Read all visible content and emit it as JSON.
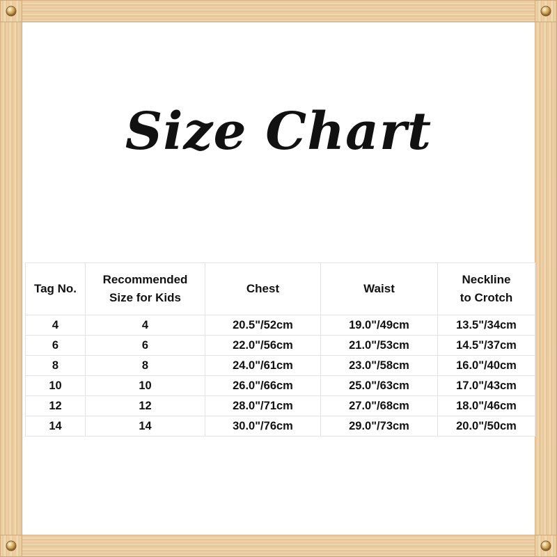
{
  "document": {
    "title": "Size Chart",
    "frame": {
      "material": "wood",
      "wood_color": "#eccb9c",
      "screw_color": "#b88b46",
      "screws": [
        "screw-top-left",
        "screw-top-right",
        "screw-bottom-left",
        "screw-bottom-right"
      ]
    },
    "background_color": "#ffffff",
    "text_color": "#111111",
    "border_color": "#e3e3e3"
  },
  "table": {
    "headers": [
      {
        "lines": [
          "Tag No."
        ]
      },
      {
        "lines": [
          "Recommended",
          "Size for Kids"
        ]
      },
      {
        "lines": [
          "Chest"
        ]
      },
      {
        "lines": [
          "Waist"
        ]
      },
      {
        "lines": [
          "Neckline",
          "to Crotch"
        ]
      }
    ],
    "rows": [
      {
        "tag_no": "4",
        "recommended_size": "4",
        "chest": "20.5\"/52cm",
        "waist": "19.0\"/49cm",
        "neckline_to_crotch": "13.5\"/34cm"
      },
      {
        "tag_no": "6",
        "recommended_size": "6",
        "chest": "22.0\"/56cm",
        "waist": "21.0\"/53cm",
        "neckline_to_crotch": "14.5\"/37cm"
      },
      {
        "tag_no": "8",
        "recommended_size": "8",
        "chest": "24.0\"/61cm",
        "waist": "23.0\"/58cm",
        "neckline_to_crotch": "16.0\"/40cm"
      },
      {
        "tag_no": "10",
        "recommended_size": "10",
        "chest": "26.0\"/66cm",
        "waist": "25.0\"/63cm",
        "neckline_to_crotch": "17.0\"/43cm"
      },
      {
        "tag_no": "12",
        "recommended_size": "12",
        "chest": "28.0\"/71cm",
        "waist": "27.0\"/68cm",
        "neckline_to_crotch": "18.0\"/46cm"
      },
      {
        "tag_no": "14",
        "recommended_size": "14",
        "chest": "30.0\"/76cm",
        "waist": "29.0\"/73cm",
        "neckline_to_crotch": "20.0\"/50cm"
      }
    ]
  }
}
